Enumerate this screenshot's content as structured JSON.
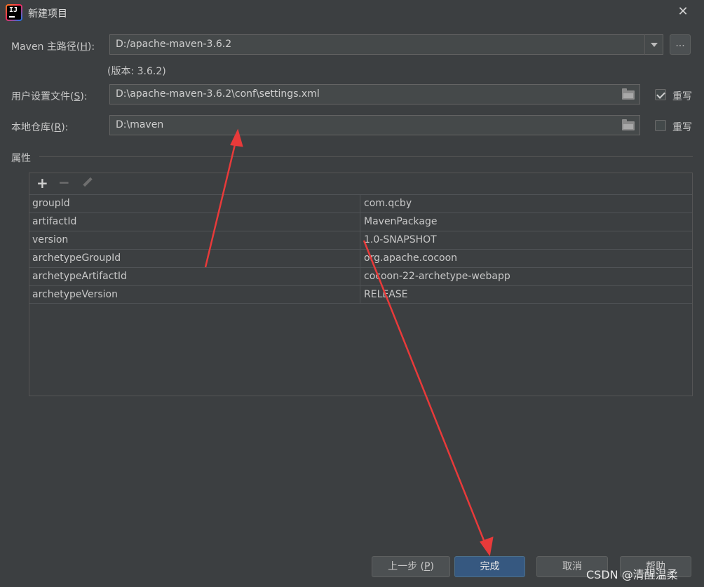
{
  "window": {
    "title": "新建项目",
    "logo_text": "IJ"
  },
  "maven_home": {
    "label": "Maven 主路径(",
    "mnemonic": "H",
    "label_end": "):",
    "value": "D:/apache-maven-3.6.2",
    "browse_label": "..."
  },
  "version_note": "(版本: 3.6.2)",
  "settings_file": {
    "label": "用户设置文件(",
    "mnemonic": "S",
    "label_end": "):",
    "value": "D:\\apache-maven-3.6.2\\conf\\settings.xml",
    "override_label": "重写",
    "override_checked": true
  },
  "local_repo": {
    "label": "本地仓库(",
    "mnemonic": "R",
    "label_end": "):",
    "value": "D:\\maven",
    "override_label": "重写",
    "override_checked": false
  },
  "properties": {
    "section_label": "属性",
    "rows": [
      {
        "key": "groupId",
        "value": "com.qcby"
      },
      {
        "key": "artifactId",
        "value": "MavenPackage"
      },
      {
        "key": "version",
        "value": "1.0-SNAPSHOT"
      },
      {
        "key": "archetypeGroupId",
        "value": "org.apache.cocoon"
      },
      {
        "key": "archetypeArtifactId",
        "value": "cocoon-22-archetype-webapp"
      },
      {
        "key": "archetypeVersion",
        "value": "RELEASE"
      }
    ]
  },
  "buttons": {
    "previous": {
      "label": "上一步 (",
      "mnemonic": "P",
      "label_end": ")"
    },
    "finish": "完成",
    "cancel": "取消",
    "help": "帮助"
  },
  "watermark": "CSDN @清醒温柔",
  "colors": {
    "background": "#3c3f41",
    "field": "#45494a",
    "primary": "#365880",
    "annotation_arrow": "#e83a3a"
  }
}
